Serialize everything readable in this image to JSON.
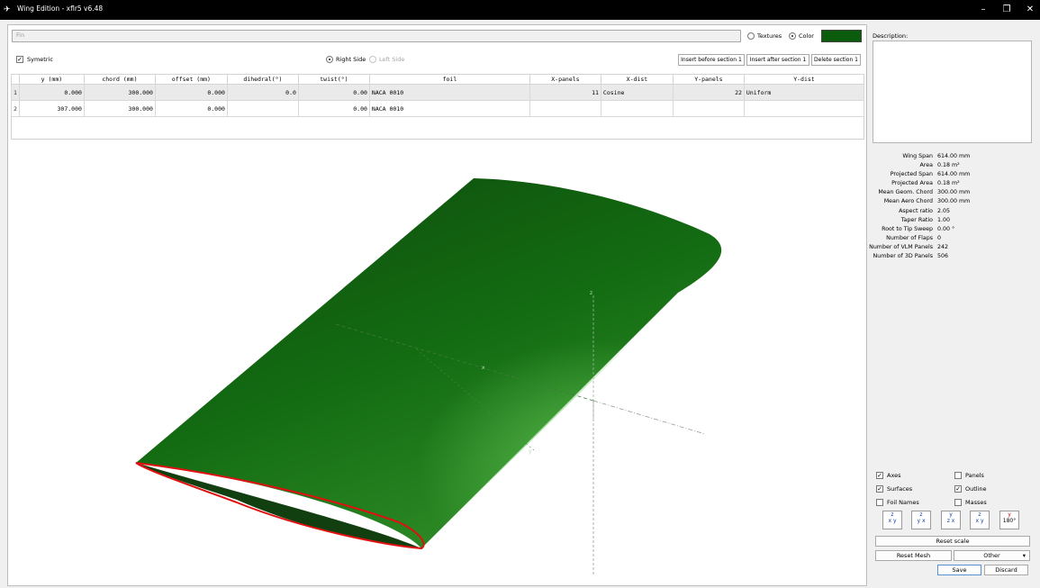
{
  "window": {
    "title": "Wing Edition - xflr5 v6.48",
    "minimize": "–",
    "restore": "❐",
    "close": "✕"
  },
  "name_field": {
    "placeholder": "Fin"
  },
  "appearance": {
    "textures_label": "Textures",
    "color_label": "Color",
    "color_value": "#0b5c0c",
    "selected": "Color"
  },
  "symmetric": {
    "label": "Symetric",
    "checked": true
  },
  "side": {
    "right_label": "Right Side",
    "left_label": "Left Side",
    "selected": "Right Side"
  },
  "section_buttons": {
    "insert_before": "Insert before section 1",
    "insert_after": "Insert after section 1",
    "delete": "Delete section 1"
  },
  "table": {
    "headers": [
      "y (mm)",
      "chord (mm)",
      "offset (mm)",
      "dihedral(°)",
      "twist(°)",
      "foil",
      "X-panels",
      "X-dist",
      "Y-panels",
      "Y-dist"
    ],
    "rows": [
      {
        "index": "1",
        "y": "0.000",
        "chord": "300.000",
        "offset": "0.000",
        "dihedral": "0.0",
        "twist": "0.00",
        "foil": "NACA 0010",
        "xpanels": "11",
        "xdist": "Cosine",
        "ypanels": "22",
        "ydist": "Uniform"
      },
      {
        "index": "2",
        "y": "307.000",
        "chord": "300.000",
        "offset": "0.000",
        "dihedral": "",
        "twist": "0.00",
        "foil": "NACA 0010",
        "xpanels": "",
        "xdist": "",
        "ypanels": "",
        "ydist": ""
      }
    ]
  },
  "viewport": {
    "axis_x": "x",
    "axis_y": "y",
    "axis_z": "z",
    "wing_color": "#0b5c0c",
    "outline_color": "#e01010"
  },
  "description": {
    "label": "Description:"
  },
  "stats": [
    {
      "label": "Wing Span",
      "value": "614.00  mm"
    },
    {
      "label": "Area",
      "value": "0.18  m²"
    },
    {
      "label": "Projected Span",
      "value": "614.00  mm"
    },
    {
      "label": "Projected Area",
      "value": "0.18  m²"
    },
    {
      "label": "Mean Geom. Chord",
      "value": "300.00  mm"
    },
    {
      "label": "Mean Aero Chord",
      "value": "300.00  mm"
    },
    {
      "label": "Aspect ratio",
      "value": "2.05"
    },
    {
      "label": "Taper Ratio",
      "value": "1.00"
    },
    {
      "label": "Root to Tip Sweep",
      "value": "0.00  °"
    },
    {
      "label": "Number of Flaps",
      "value": "0"
    },
    {
      "label": "Number of VLM Panels",
      "value": "242"
    },
    {
      "label": "Number of 3D Panels",
      "value": "506"
    }
  ],
  "display": {
    "axes": {
      "label": "Axes",
      "checked": true
    },
    "panels": {
      "label": "Panels",
      "checked": false
    },
    "surfaces": {
      "label": "Surfaces",
      "checked": true
    },
    "outline": {
      "label": "Outline",
      "checked": true
    },
    "foil_names": {
      "label": "Foil Names",
      "checked": false
    },
    "masses": {
      "label": "Masses",
      "checked": false
    }
  },
  "view_buttons": [
    {
      "name": "x-y-view-icon",
      "top": "z",
      "bottom": "x  y"
    },
    {
      "name": "y-x-view-icon",
      "top": "z",
      "bottom": "y  x"
    },
    {
      "name": "z-x-view-icon",
      "top": "y",
      "bottom": "z  x"
    },
    {
      "name": "x-y-iso-view-icon",
      "top": "z",
      "bottom": "x  y"
    },
    {
      "name": "flip-180-view-icon",
      "top": "y",
      "bottom": "180°"
    }
  ],
  "buttons": {
    "reset_scale": "Reset scale",
    "reset_mesh": "Reset Mesh",
    "other": "Other",
    "other_arrow": "▾",
    "save": "Save",
    "discard": "Discard"
  }
}
